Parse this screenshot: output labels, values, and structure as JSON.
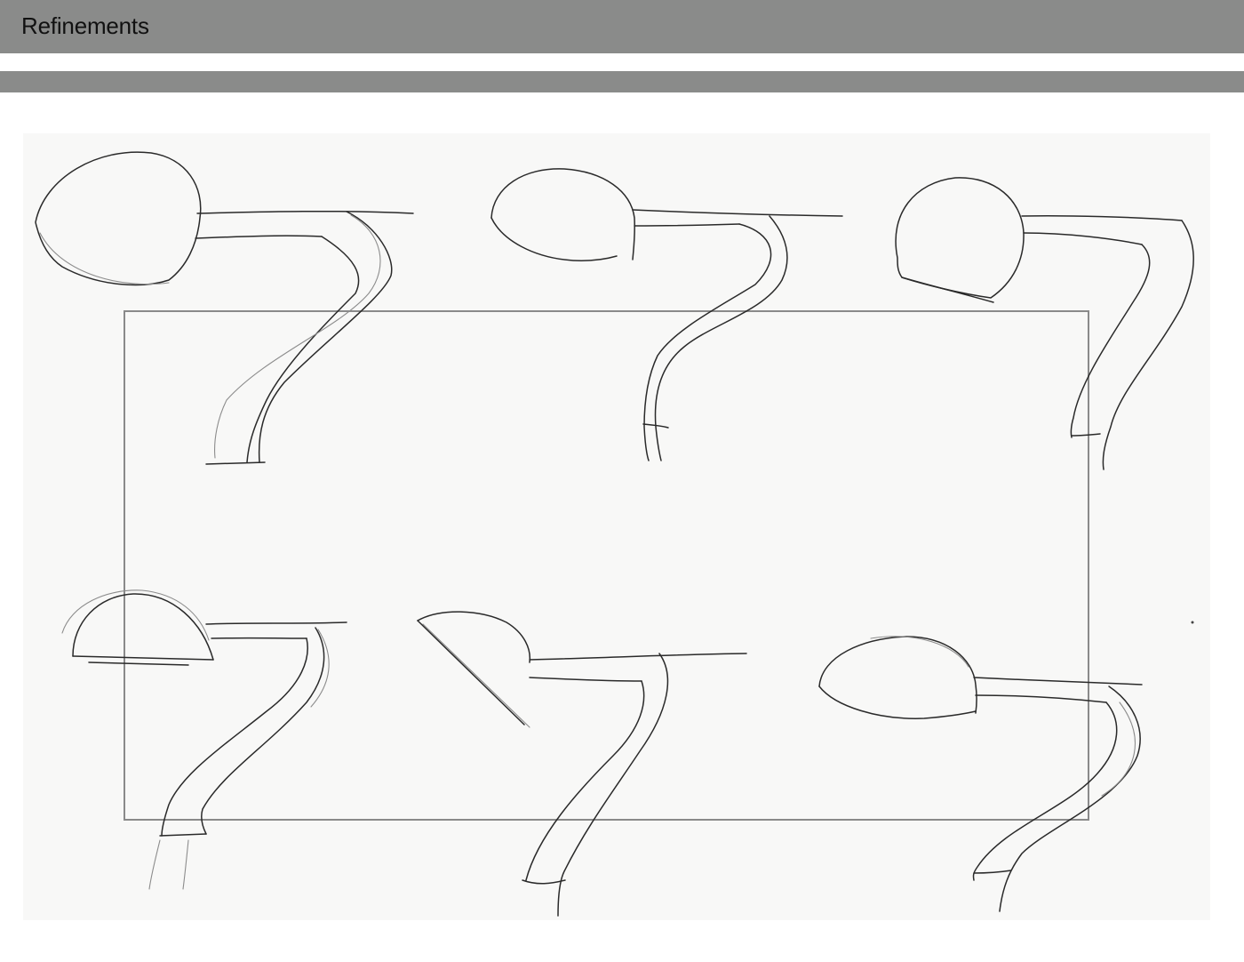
{
  "header": {
    "title": "Refinements",
    "bar_color": "#8a8b8a"
  },
  "sketch_sheet": {
    "lamp_sketch_count": 6,
    "paper_color": "#f8f8f7",
    "ink_color": "#2a2a2a"
  }
}
